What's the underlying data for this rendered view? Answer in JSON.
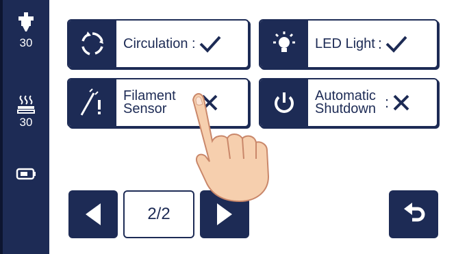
{
  "status_rail": {
    "nozzle": {
      "icon": "nozzle-icon",
      "value": "30"
    },
    "bed": {
      "icon": "heated-bed-icon",
      "value": "30"
    },
    "storage": {
      "icon": "usb-drive-icon"
    }
  },
  "settings": [
    {
      "label": "Circulation :",
      "icon": "circulation-icon",
      "state": "check-icon"
    },
    {
      "label": "LED Light",
      "colon": ":",
      "icon": "light-bulb-icon",
      "state": "check-icon"
    },
    {
      "label_line1": "Filament",
      "label_line2": "Sensor",
      "colon": ":",
      "icon": "filament-sensor-icon",
      "state": "cross-icon"
    },
    {
      "label_line1": "Automatic",
      "label_line2": "Shutdown",
      "colon": ":",
      "icon": "power-icon",
      "state": "cross-icon"
    }
  ],
  "pagination": {
    "page": "2/2"
  },
  "overlay": {
    "icon": "pointing-hand-icon"
  },
  "colors": {
    "navy": "#1d2b55",
    "background": "#ffffff"
  }
}
